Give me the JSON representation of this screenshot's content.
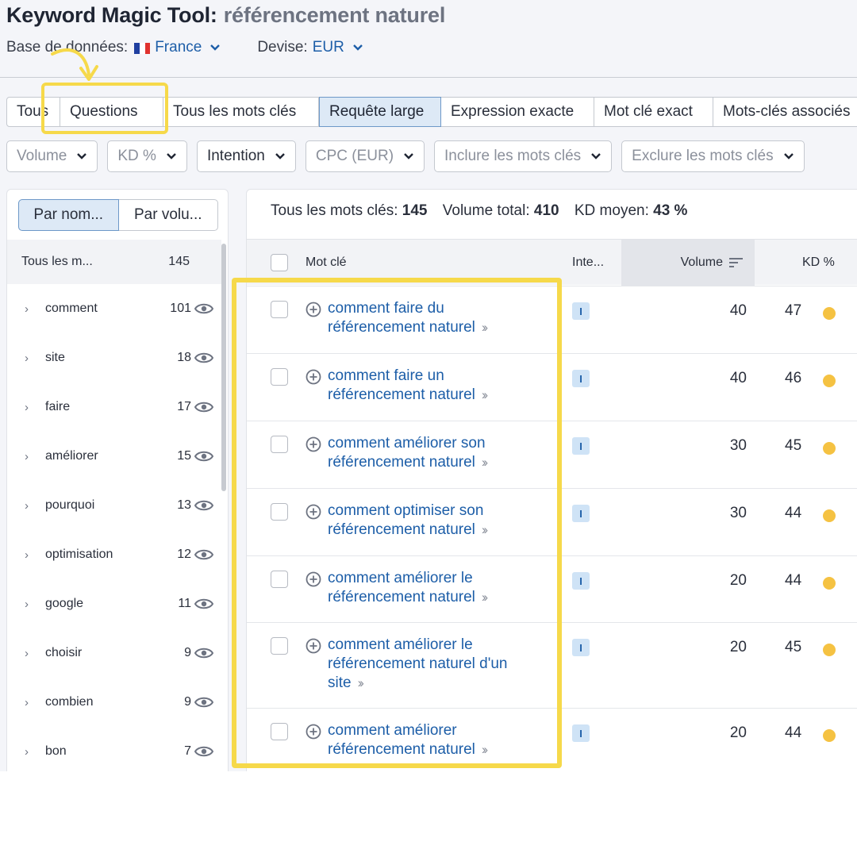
{
  "header": {
    "title": "Keyword Magic Tool:",
    "query": "référencement naturel",
    "database_label": "Base de données:",
    "database_value": "France",
    "currency_label": "Devise:",
    "currency_value": "EUR"
  },
  "tabs": [
    {
      "label": "Tous",
      "selected": false
    },
    {
      "label": "Questions",
      "selected": false
    },
    {
      "label": "Tous les mots clés",
      "selected": false
    },
    {
      "label": "Requête large",
      "selected": true
    },
    {
      "label": "Expression exacte",
      "selected": false
    },
    {
      "label": "Mot clé exact",
      "selected": false
    },
    {
      "label": "Mots-clés associés",
      "selected": false
    }
  ],
  "filters": [
    "Volume",
    "KD %",
    "Intention",
    "CPC (EUR)",
    "Inclure les mots clés",
    "Exclure les mots clés"
  ],
  "left_panel": {
    "seg_by_name": "Par nom...",
    "seg_by_volume": "Par volu...",
    "all_label": "Tous les m...",
    "all_count": "145",
    "groups": [
      {
        "label": "comment",
        "count": "101"
      },
      {
        "label": "site",
        "count": "18"
      },
      {
        "label": "faire",
        "count": "17"
      },
      {
        "label": "améliorer",
        "count": "15"
      },
      {
        "label": "pourquoi",
        "count": "13"
      },
      {
        "label": "optimisation",
        "count": "12"
      },
      {
        "label": "google",
        "count": "11"
      },
      {
        "label": "choisir",
        "count": "9"
      },
      {
        "label": "combien",
        "count": "9"
      },
      {
        "label": "bon",
        "count": "7"
      }
    ]
  },
  "summary": {
    "all_label": "Tous les mots clés:",
    "all_value": "145",
    "volume_label": "Volume total:",
    "volume_value": "410",
    "kd_label": "KD moyen:",
    "kd_value": "43 %"
  },
  "table": {
    "col_keyword": "Mot clé",
    "col_intent": "Inte...",
    "col_volume": "Volume",
    "col_kd": "KD %",
    "rows": [
      {
        "keyword": "comment faire du référencement naturel",
        "intent": "I",
        "volume": "40",
        "kd": "47"
      },
      {
        "keyword": "comment faire un référencement naturel",
        "intent": "I",
        "volume": "40",
        "kd": "46"
      },
      {
        "keyword": "comment améliorer son référencement naturel",
        "intent": "I",
        "volume": "30",
        "kd": "45"
      },
      {
        "keyword": "comment optimiser son référencement naturel",
        "intent": "I",
        "volume": "30",
        "kd": "44"
      },
      {
        "keyword": "comment améliorer le référencement naturel",
        "intent": "I",
        "volume": "20",
        "kd": "44"
      },
      {
        "keyword": "comment améliorer le référencement naturel d'un site",
        "intent": "I",
        "volume": "20",
        "kd": "45"
      },
      {
        "keyword": "comment améliorer référencement naturel",
        "intent": "I",
        "volume": "20",
        "kd": "44"
      }
    ]
  },
  "colors": {
    "accent_blue": "#1d5ea8",
    "highlight_yellow": "#f6d94a",
    "kd_dot": "#f5c242",
    "intent_bg": "#cfe3f6"
  }
}
